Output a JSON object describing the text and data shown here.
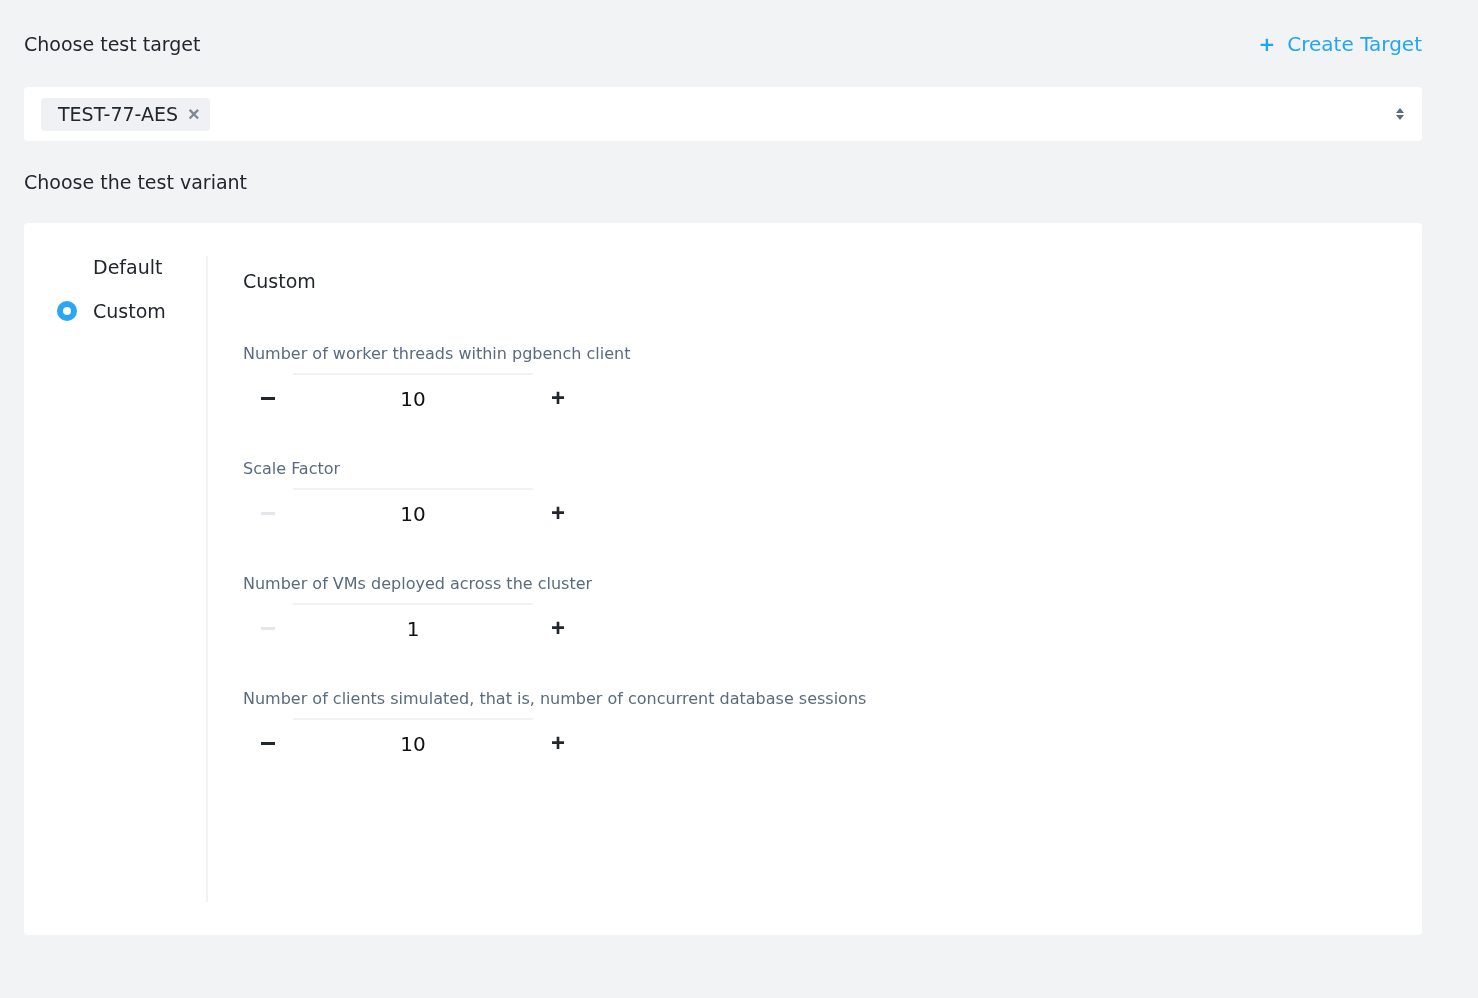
{
  "target_section": {
    "title": "Choose test target",
    "create_button": {
      "icon": "+",
      "label": "Create Target"
    }
  },
  "target_select": {
    "tags": [
      {
        "label": "TEST-77-AES",
        "remove": "×"
      }
    ]
  },
  "variant_section": {
    "title": "Choose the test variant"
  },
  "variants": [
    {
      "label": "Default",
      "selected": false
    },
    {
      "label": "Custom",
      "selected": true
    }
  ],
  "panel": {
    "title": "Custom",
    "fields": [
      {
        "label": "Number of worker threads within pgbench client",
        "value": "10",
        "minus_disabled": false
      },
      {
        "label": "Scale Factor",
        "value": "10",
        "minus_disabled": true
      },
      {
        "label": "Number of VMs deployed across the cluster",
        "value": "1",
        "minus_disabled": true
      },
      {
        "label": "Number of clients simulated, that is, number of concurrent database sessions",
        "value": "10",
        "minus_disabled": false
      }
    ]
  }
}
